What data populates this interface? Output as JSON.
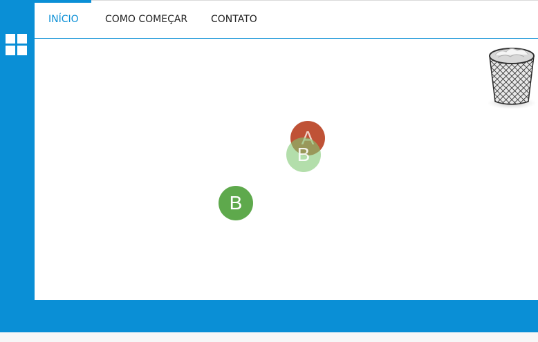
{
  "nav": {
    "tabs": [
      {
        "label": "INÍCIO",
        "active": true
      },
      {
        "label": "COMO COMEÇAR",
        "active": false
      },
      {
        "label": "CONTATO",
        "active": false
      }
    ]
  },
  "sidebar": {
    "menu_icon": "grid-icon"
  },
  "workspace": {
    "trash_icon": "trash-can-icon",
    "nodes": [
      {
        "label": "A",
        "color": "#bf5236"
      },
      {
        "label": "B",
        "color": "#80c873",
        "state": "drag-ghost"
      },
      {
        "label": "B",
        "color": "#5ea94c"
      }
    ]
  },
  "colors": {
    "accent": "#0a8fd6",
    "node_a": "#bf5236",
    "node_b": "#5ea94c"
  }
}
